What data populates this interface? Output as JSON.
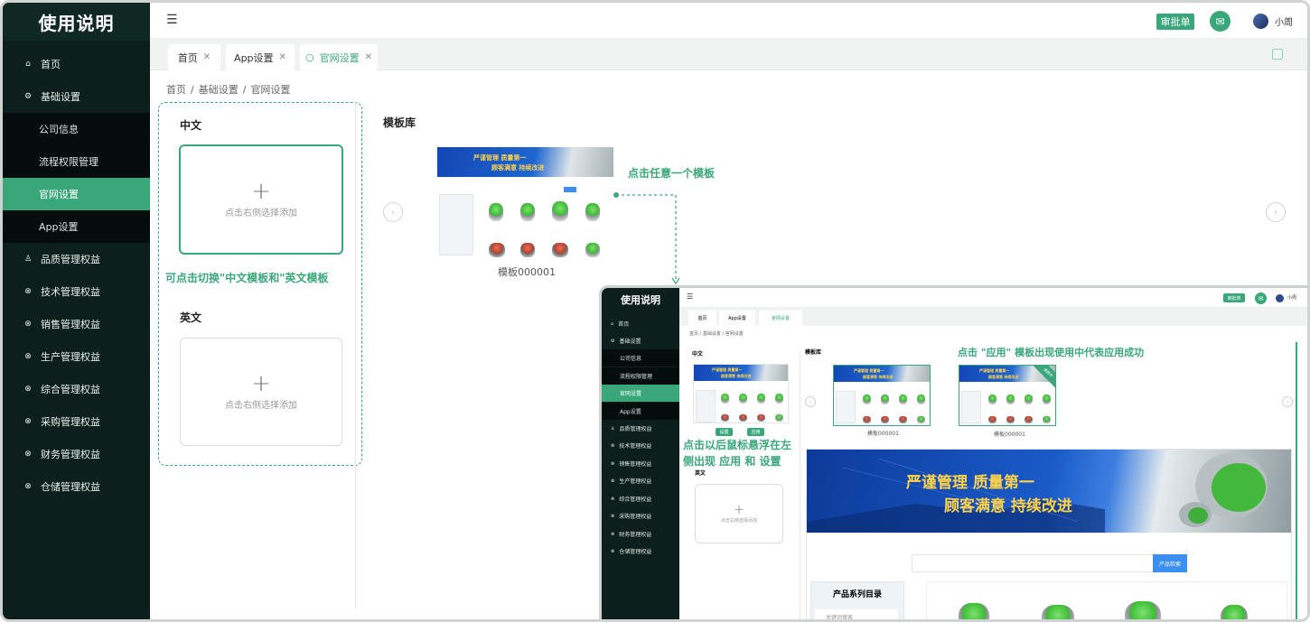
{
  "sidebar": {
    "title": "使用说明",
    "items": [
      {
        "label": "首页",
        "icon": "home-icon"
      },
      {
        "label": "基础设置",
        "icon": "gear-icon"
      },
      {
        "label": "品质管理权益",
        "icon": "user-icon"
      },
      {
        "label": "技术管理权益",
        "icon": "cross-icon"
      },
      {
        "label": "销售管理权益",
        "icon": "cross-icon"
      },
      {
        "label": "生产管理权益",
        "icon": "cross-icon"
      },
      {
        "label": "综合管理权益",
        "icon": "cross-icon"
      },
      {
        "label": "采购管理权益",
        "icon": "cross-icon"
      },
      {
        "label": "财务管理权益",
        "icon": "cross-icon"
      },
      {
        "label": "仓储管理权益",
        "icon": "cross-icon"
      }
    ],
    "sub_items": [
      "公司信息",
      "流程权限管理",
      "官网设置",
      "App设置"
    ],
    "active_sub": "官网设置"
  },
  "header": {
    "approve_label": "审批单",
    "user_name": "小周"
  },
  "tabs": [
    {
      "label": "首页"
    },
    {
      "label": "App设置"
    },
    {
      "label": "官网设置"
    }
  ],
  "breadcrumb": [
    "首页",
    "/",
    "基础设置",
    "/",
    "官网设置"
  ],
  "left_panel": {
    "cn_title": "中文",
    "en_title": "英文",
    "add_hint": "点击右侧选择添加",
    "annotation": "可点击切换\"中文模板和\"英文模板"
  },
  "library": {
    "title": "模板库",
    "template_name": "模板000001",
    "annotation": "点击任意一个模板",
    "banner_line1": "严谨管理  质量第一",
    "banner_line2": "顾客满意  持续改进"
  },
  "inset": {
    "annotation_top": "点击 \"应用\" 模板出现使用中代表应用成功",
    "annotation_left_1": "点击以后鼠标悬浮在左",
    "annotation_left_2": "侧出现  应用  和  设置",
    "set_label": "设置",
    "apply_label": "应用",
    "search_btn": "产品检索",
    "catalog_title": "产品系列目录",
    "keyword_placeholder": "关键词搜索",
    "in_use_badge": "使用中"
  },
  "colors": {
    "accent": "#3aa77a",
    "sidebar_bg": "#0c1f1c"
  }
}
